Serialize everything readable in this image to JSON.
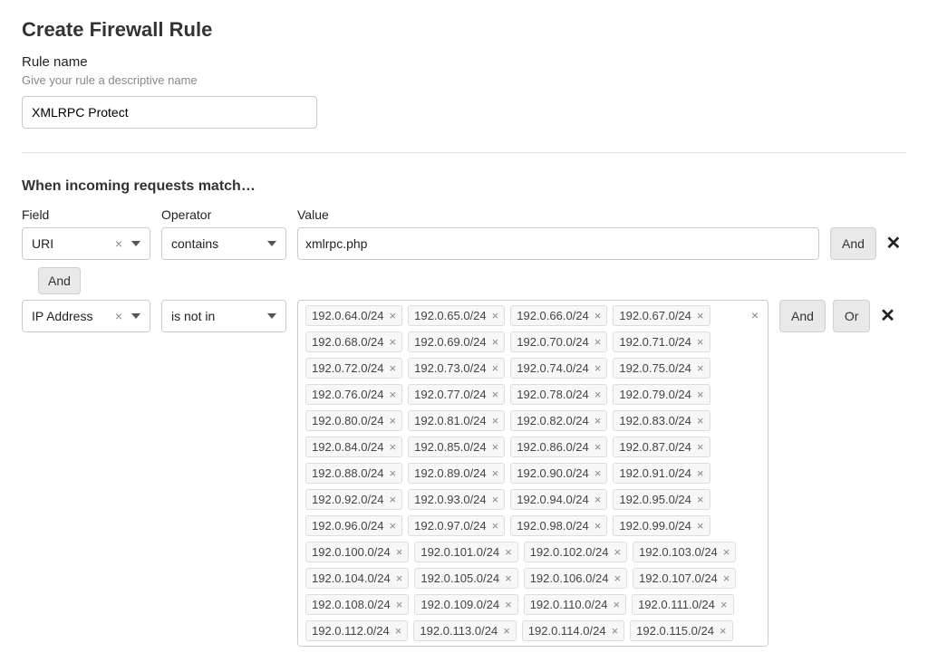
{
  "page": {
    "title": "Create Firewall Rule",
    "ruleName": {
      "label": "Rule name",
      "hint": "Give your rule a descriptive name",
      "value": "XMLRPC Protect"
    },
    "matchHeading": "When incoming requests match…",
    "columns": {
      "field": "Field",
      "operator": "Operator",
      "value": "Value"
    },
    "buttons": {
      "and": "And",
      "or": "Or"
    }
  },
  "rules": [
    {
      "field": "URI",
      "operator": "contains",
      "valueType": "text",
      "value": "xmlrpc.php",
      "actions": [
        "and"
      ]
    },
    {
      "joiner": "And",
      "field": "IP Address",
      "operator": "is not in",
      "valueType": "chips",
      "actions": [
        "and",
        "or"
      ],
      "chips": [
        "192.0.64.0/24",
        "192.0.65.0/24",
        "192.0.66.0/24",
        "192.0.67.0/24",
        "192.0.68.0/24",
        "192.0.69.0/24",
        "192.0.70.0/24",
        "192.0.71.0/24",
        "192.0.72.0/24",
        "192.0.73.0/24",
        "192.0.74.0/24",
        "192.0.75.0/24",
        "192.0.76.0/24",
        "192.0.77.0/24",
        "192.0.78.0/24",
        "192.0.79.0/24",
        "192.0.80.0/24",
        "192.0.81.0/24",
        "192.0.82.0/24",
        "192.0.83.0/24",
        "192.0.84.0/24",
        "192.0.85.0/24",
        "192.0.86.0/24",
        "192.0.87.0/24",
        "192.0.88.0/24",
        "192.0.89.0/24",
        "192.0.90.0/24",
        "192.0.91.0/24",
        "192.0.92.0/24",
        "192.0.93.0/24",
        "192.0.94.0/24",
        "192.0.95.0/24",
        "192.0.96.0/24",
        "192.0.97.0/24",
        "192.0.98.0/24",
        "192.0.99.0/24",
        "192.0.100.0/24",
        "192.0.101.0/24",
        "192.0.102.0/24",
        "192.0.103.0/24",
        "192.0.104.0/24",
        "192.0.105.0/24",
        "192.0.106.0/24",
        "192.0.107.0/24",
        "192.0.108.0/24",
        "192.0.109.0/24",
        "192.0.110.0/24",
        "192.0.111.0/24",
        "192.0.112.0/24",
        "192.0.113.0/24",
        "192.0.114.0/24",
        "192.0.115.0/24"
      ]
    }
  ]
}
